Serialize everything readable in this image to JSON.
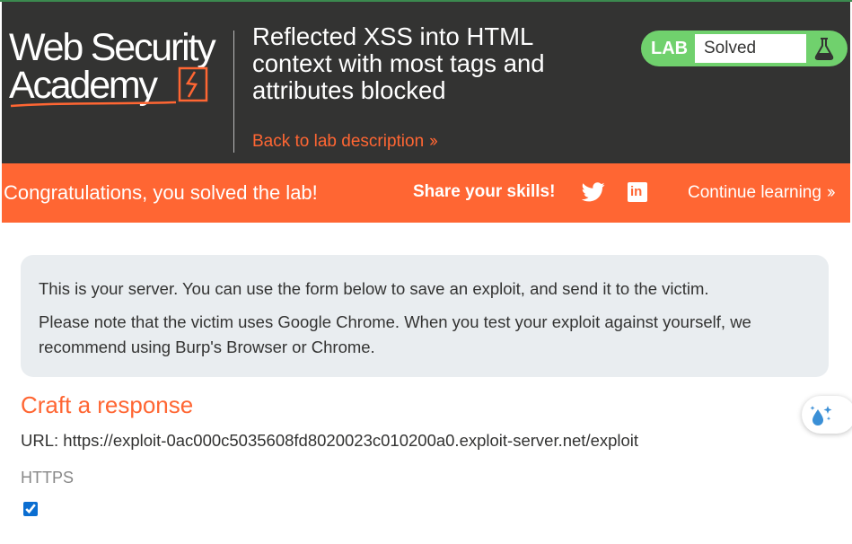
{
  "header": {
    "logo": {
      "line1": "Web Security",
      "line2": "Academy"
    },
    "lab_title": "Reflected XSS into HTML context with most tags and attributes blocked",
    "back_link": "Back to lab description",
    "lab_badge": {
      "label": "LAB",
      "status": "Solved"
    }
  },
  "banner": {
    "congrats": "Congratulations, you solved the lab!",
    "share": "Share your skills!",
    "continue": "Continue learning"
  },
  "info": {
    "p1": "This is your server. You can use the form below to save an exploit, and send it to the victim.",
    "p2": "Please note that the victim uses Google Chrome. When you test your exploit against yourself, we recommend using Burp's Browser or Chrome."
  },
  "form": {
    "heading": "Craft a response",
    "url": "URL: https://exploit-0ac000c5035608fd8020023c010200a0.exploit-server.net/exploit",
    "https_label": "HTTPS",
    "https_checked": true
  },
  "icons": {
    "twitter": "twitter-icon",
    "linkedin": "linkedin-icon",
    "flask": "flask-icon",
    "assistant": "sparkle-droplet-icon"
  },
  "colors": {
    "header_bg": "#333332",
    "accent_orange": "#ff6633",
    "lab_green": "#70d16d",
    "info_bg": "#e9edf0"
  }
}
